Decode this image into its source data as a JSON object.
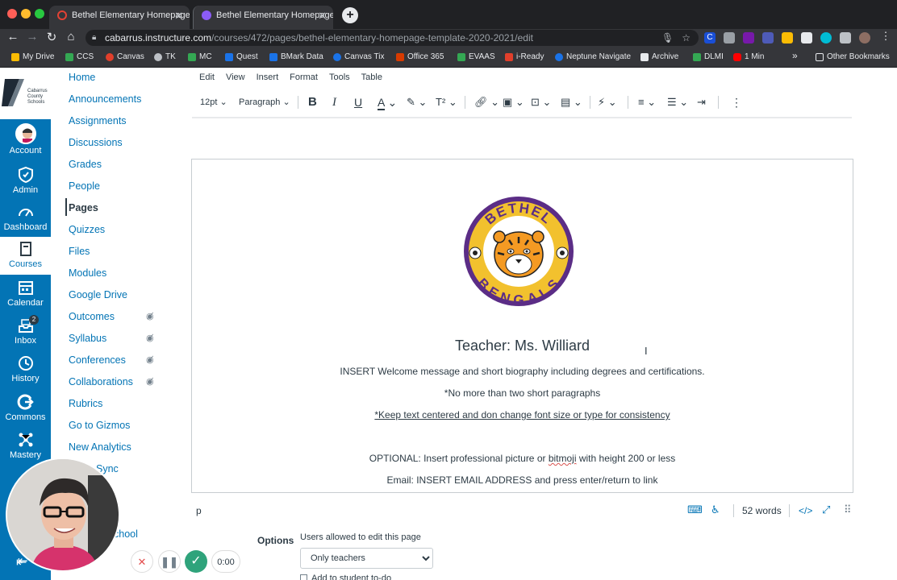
{
  "browser": {
    "tabs": [
      {
        "title": "Bethel Elementary Homepage",
        "active": false,
        "icon_color": "#e34234"
      },
      {
        "title": "Bethel Elementary Homepage",
        "active": true,
        "icon_color": "#8b5cf6"
      }
    ],
    "url_host": "cabarrus.instructure.com",
    "url_path": "/courses/472/pages/bethel-elementary-homepage-template-2020-2021/edit",
    "bookmarks": [
      {
        "label": "My Drive",
        "color": "#fbbc04"
      },
      {
        "label": "CCS",
        "color": "#34a853"
      },
      {
        "label": "Canvas",
        "color": "#e13f2b"
      },
      {
        "label": "TK",
        "color": "#bdc1c6"
      },
      {
        "label": "MC",
        "color": "#34a853"
      },
      {
        "label": "Quest",
        "color": "#1a73e8"
      },
      {
        "label": "BMark Data",
        "color": "#1a73e8"
      },
      {
        "label": "Canvas Tix",
        "color": "#1a73e8"
      },
      {
        "label": "Office 365",
        "color": "#d83b01"
      },
      {
        "label": "EVAAS",
        "color": "#34a853"
      },
      {
        "label": "i-Ready",
        "color": "#e13f2b"
      },
      {
        "label": "Neptune Navigate",
        "color": "#1a73e8"
      },
      {
        "label": "Archive",
        "color": "#e8eaed"
      },
      {
        "label": "DLMI",
        "color": "#34a853"
      },
      {
        "label": "1 Min",
        "color": "#ff0000"
      }
    ],
    "more_bookmarks": "»",
    "other_bookmarks": "Other Bookmarks"
  },
  "global_nav": {
    "logo_text": "Cabarrus County Schools",
    "items": [
      {
        "label": "Account",
        "icon": "avatar-icon"
      },
      {
        "label": "Admin",
        "icon": "shield-icon"
      },
      {
        "label": "Dashboard",
        "icon": "dashboard-icon"
      },
      {
        "label": "Courses",
        "icon": "book-icon",
        "active": true
      },
      {
        "label": "Calendar",
        "icon": "calendar-icon"
      },
      {
        "label": "Inbox",
        "icon": "inbox-icon",
        "badge": "2"
      },
      {
        "label": "History",
        "icon": "clock-icon"
      },
      {
        "label": "Commons",
        "icon": "commons-icon"
      },
      {
        "label": "Mastery",
        "icon": "mastery-icon"
      }
    ]
  },
  "course_nav": {
    "items": [
      {
        "label": "Home"
      },
      {
        "label": "Announcements"
      },
      {
        "label": "Assignments"
      },
      {
        "label": "Discussions"
      },
      {
        "label": "Grades"
      },
      {
        "label": "People"
      },
      {
        "label": "Pages",
        "active": true
      },
      {
        "label": "Quizzes"
      },
      {
        "label": "Files"
      },
      {
        "label": "Modules"
      },
      {
        "label": "Google Drive"
      },
      {
        "label": "Outcomes",
        "hidden": true
      },
      {
        "label": "Syllabus",
        "hidden": true
      },
      {
        "label": "Conferences",
        "hidden": true
      },
      {
        "label": "Collaborations",
        "hidden": true
      },
      {
        "label": "Rubrics"
      },
      {
        "label": "Go to Gizmos"
      },
      {
        "label": "New Analytics"
      },
      {
        "label": "Sync"
      },
      {
        "label": "chool"
      }
    ]
  },
  "editor": {
    "menus": [
      "Edit",
      "View",
      "Insert",
      "Format",
      "Tools",
      "Table"
    ],
    "font_size": "12pt",
    "block_format": "Paragraph",
    "logo": {
      "top_text": "BETHEL",
      "bottom_text": "BENGALS"
    },
    "content": {
      "title": "Teacher: Ms. Williard",
      "line1": "INSERT Welcome message and short biography including degrees and certifications.",
      "line2": "*No more than two short paragraphs",
      "line3": "*Keep text centered and don change font size or type for consistency ",
      "line4_a": "OPTIONAL: Insert professional picture or ",
      "line4_b": "bitmoji",
      "line4_c": " with height 200 or less",
      "line5": "Email: INSERT EMAIL ADDRESS and press enter/return to link"
    },
    "status": {
      "path": "p",
      "word_count": "52 words",
      "html_toggle": "</>"
    }
  },
  "options": {
    "label": "Options",
    "edit_label": "Users allowed to edit this page",
    "edit_value": "Only teachers",
    "todo_label": "Add to student to-do"
  },
  "recorder": {
    "time": "0:00",
    "accent": "#2fa37b"
  }
}
